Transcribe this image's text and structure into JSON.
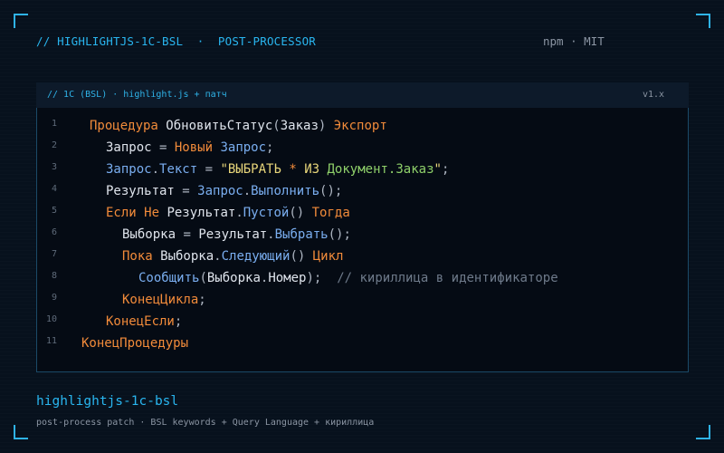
{
  "header": {
    "title": "// HIGHLIGHTJS-1C-BSL  ·  POST-PROCESSOR",
    "meta": "npm · MIT"
  },
  "panel": {
    "language": "// 1C (BSL) · highlight.js + патч",
    "version": "v1.x"
  },
  "code_lines": [
    {
      "n": "1",
      "tokens": [
        [
          "kw",
          "Процедура"
        ],
        [
          "id",
          " ОбновитьСтатус"
        ],
        [
          "op",
          "("
        ],
        [
          "id",
          "Заказ"
        ],
        [
          "op",
          ") "
        ],
        [
          "kw",
          "Экспорт"
        ]
      ]
    },
    {
      "n": "2",
      "tokens": [
        [
          "id",
          "Запрос"
        ],
        [
          "op",
          " = "
        ],
        [
          "kw",
          "Новый"
        ],
        [
          "id",
          " "
        ],
        [
          "fn",
          "Запрос"
        ],
        [
          "op",
          ";"
        ]
      ]
    },
    {
      "n": "3",
      "tokens": [
        [
          "fn",
          "Запрос"
        ],
        [
          "op",
          "."
        ],
        [
          "fn",
          "Текст"
        ],
        [
          "op",
          " = "
        ],
        [
          "strq",
          "\"ВЫБРАТЬ"
        ],
        [
          "kw",
          " * "
        ],
        [
          "strq",
          "ИЗ "
        ],
        [
          "str",
          "Документ.Заказ"
        ],
        [
          "strq",
          "\""
        ],
        [
          "op",
          ";"
        ]
      ]
    },
    {
      "n": "4",
      "tokens": [
        [
          "id",
          "Результат"
        ],
        [
          "op",
          " = "
        ],
        [
          "fn",
          "Запрос"
        ],
        [
          "op",
          "."
        ],
        [
          "fn",
          "Выполнить"
        ],
        [
          "op",
          "();"
        ]
      ]
    },
    {
      "n": "5",
      "tokens": [
        [
          "kw",
          "Если"
        ],
        [
          "id",
          " "
        ],
        [
          "kw",
          "Не"
        ],
        [
          "id",
          " Результат"
        ],
        [
          "op",
          "."
        ],
        [
          "fn",
          "Пустой"
        ],
        [
          "op",
          "() "
        ],
        [
          "kw",
          "Тогда"
        ]
      ]
    },
    {
      "n": "6",
      "tokens": [
        [
          "id",
          "Выборка"
        ],
        [
          "op",
          " = "
        ],
        [
          "id",
          "Результат"
        ],
        [
          "op",
          "."
        ],
        [
          "fn",
          "Выбрать"
        ],
        [
          "op",
          "();"
        ]
      ]
    },
    {
      "n": "7",
      "tokens": [
        [
          "kw",
          "Пока"
        ],
        [
          "id",
          " Выборка"
        ],
        [
          "op",
          "."
        ],
        [
          "fn",
          "Следующий"
        ],
        [
          "op",
          "() "
        ],
        [
          "kw",
          "Цикл"
        ]
      ]
    },
    {
      "n": "8",
      "tokens": [
        [
          "fn",
          "Сообщить"
        ],
        [
          "op",
          "("
        ],
        [
          "id",
          "Выборка"
        ],
        [
          "op",
          "."
        ],
        [
          "id",
          "Номер"
        ],
        [
          "op",
          ");  "
        ],
        [
          "cm",
          "// кириллица в идентификаторе"
        ]
      ]
    },
    {
      "n": "9",
      "tokens": [
        [
          "kw",
          "КонецЦикла"
        ],
        [
          "op",
          ";"
        ]
      ]
    },
    {
      "n": "10",
      "tokens": [
        [
          "kw",
          "КонецЕсли"
        ],
        [
          "op",
          ";"
        ]
      ]
    },
    {
      "n": "11",
      "tokens": [
        [
          "kw",
          "КонецПроцедуры"
        ]
      ]
    }
  ],
  "footer": {
    "title": "highlightjs-1c-bsl",
    "subtitle": "post-process patch · BSL keywords + Query Language + кириллица"
  },
  "colors": {
    "accent": "#29b6f0",
    "keyword": "#f28b3a",
    "function": "#7aaef0",
    "string": "#8fd06a",
    "comment": "#6e7a8a"
  }
}
